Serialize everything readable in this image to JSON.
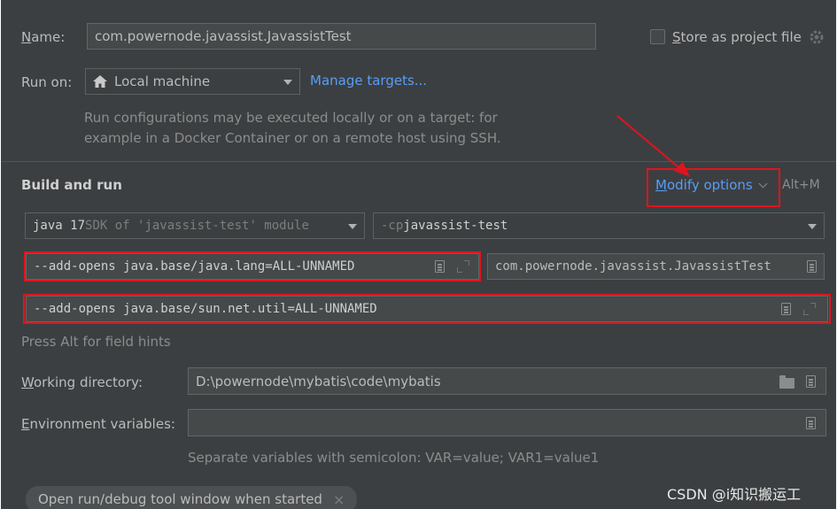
{
  "name_row": {
    "label_mnemonic": "N",
    "label_rest": "ame:",
    "value": "com.powernode.javassist.JavassistTest",
    "store_mnemonic": "S",
    "store_rest": "tore as project file"
  },
  "run_on": {
    "label": "Run on:",
    "target": "Local machine",
    "manage_link": "Manage targets...",
    "hint_line1": "Run configurations may be executed locally or on a target: for",
    "hint_line2": "example in a Docker Container or on a remote host using SSH."
  },
  "build_and_run": {
    "heading": "Build and run",
    "modify_mnemonic": "M",
    "modify_rest": "odify options",
    "modify_shortcut": "Alt+M",
    "sdk_bold": "java 17",
    "sdk_rest": " SDK of 'javassist-test' module",
    "cp_prefix": "-cp ",
    "cp_value": "javassist-test",
    "vm_options": "--add-opens java.base/java.lang=ALL-UNNAMED",
    "main_class": "com.powernode.javassist.JavassistTest",
    "program_args": "--add-opens java.base/sun.net.util=ALL-UNNAMED",
    "field_hint": "Press Alt for field hints"
  },
  "working_directory": {
    "label_mnemonic": "W",
    "label_rest": "orking directory:",
    "value": "D:\\powernode\\mybatis\\code\\mybatis"
  },
  "environment": {
    "label_mnemonic": "E",
    "label_rest": "nvironment variables:",
    "value": "",
    "hint": "Separate variables with semicolon: VAR=value; VAR1=value1"
  },
  "chip": {
    "label": "Open run/debug tool window when started",
    "close": "×"
  },
  "watermark": "CSDN @i知识搬运工",
  "icons": {
    "home": "home-icon",
    "gear": "gear-icon",
    "chevron": "chevron-down-icon",
    "document": "document-icon",
    "expand": "expand-icon",
    "folder": "folder-icon"
  },
  "colors": {
    "background": "#3c3f41",
    "field": "#45494a",
    "link": "#589df6",
    "highlight": "#e0141e"
  }
}
